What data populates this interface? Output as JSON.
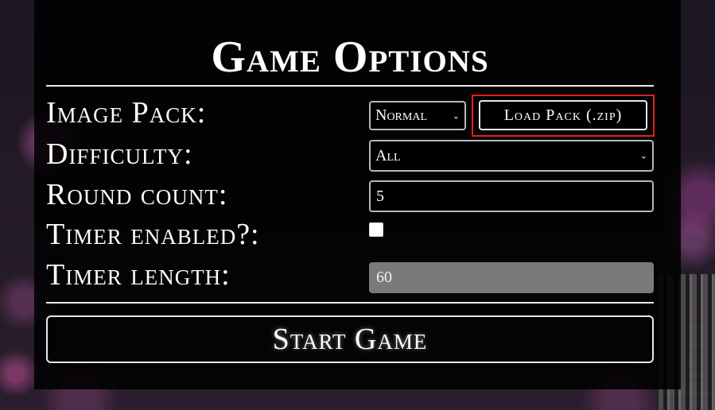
{
  "title": "Game Options",
  "fields": {
    "image_pack": {
      "label": "Image Pack:",
      "selected": "Normal",
      "load_button": "Load Pack (.zip)"
    },
    "difficulty": {
      "label": "Difficulty:",
      "selected": "All"
    },
    "round_count": {
      "label": "Round count:",
      "value": "5"
    },
    "timer_enabled": {
      "label": "Timer enabled?:",
      "checked": false
    },
    "timer_length": {
      "label": "Timer length:",
      "value": "60",
      "disabled": true
    }
  },
  "start_button": "Start Game",
  "colors": {
    "panel_bg": "#000000",
    "text": "#ffffff",
    "highlight_outline": "#e02020",
    "disabled_input": "#7a7a7a"
  }
}
